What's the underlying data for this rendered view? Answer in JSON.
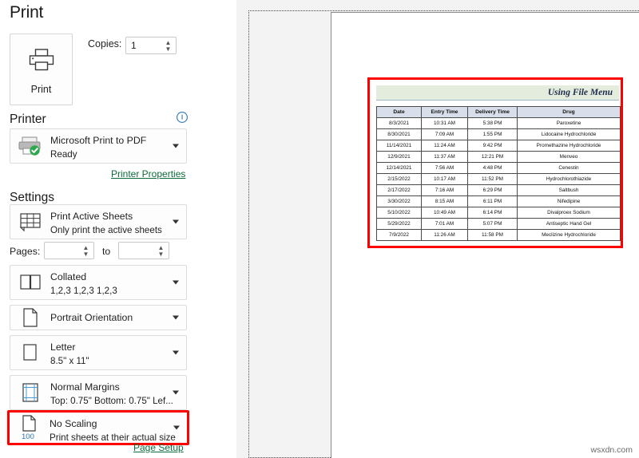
{
  "header": {
    "title": "Print"
  },
  "print_button": {
    "label": "Print",
    "icon": "printer-icon"
  },
  "copies": {
    "label": "Copies:",
    "value": "1"
  },
  "printer_section": {
    "heading": "Printer",
    "info_icon": "info-circle-icon",
    "name": "Microsoft Print to PDF",
    "status": "Ready",
    "icon": "printer-ready-icon",
    "properties_link": "Printer Properties"
  },
  "settings_section": {
    "heading": "Settings",
    "items": [
      {
        "icon": "worksheet-grid-icon",
        "primary": "Print Active Sheets",
        "secondary": "Only print the active sheets",
        "highlighted": false
      },
      {
        "icon": "collate-icon",
        "primary": "Collated",
        "secondary": "1,2,3   1,2,3   1,2,3",
        "highlighted": false
      },
      {
        "icon": "portrait-page-icon",
        "primary": "Portrait Orientation",
        "secondary": "",
        "highlighted": false
      },
      {
        "icon": "paper-size-icon",
        "primary": "Letter",
        "secondary": "8.5\" x 11\"",
        "highlighted": false
      },
      {
        "icon": "margins-icon",
        "primary": "Normal Margins",
        "secondary": "Top: 0.75\" Bottom: 0.75\" Lef...",
        "highlighted": false
      },
      {
        "icon": "scaling-icon",
        "icon_badge": "100",
        "primary": "No Scaling",
        "secondary": "Print sheets at their actual size",
        "highlighted": true
      }
    ],
    "pages": {
      "label": "Pages:",
      "from": "",
      "to_label": "to",
      "to": ""
    },
    "page_setup_link": "Page Setup"
  },
  "preview": {
    "sheet_title": "Using File Menu",
    "table": {
      "columns": [
        "Date",
        "Entry Time",
        "Delivery Time",
        "Drug"
      ],
      "rows": [
        [
          "8/3/2021",
          "10:31 AM",
          "5:38 PM",
          "Paroxetine"
        ],
        [
          "8/30/2021",
          "7:09 AM",
          "1:55 PM",
          "Lidocaine Hydrochloride"
        ],
        [
          "11/14/2021",
          "11:24 AM",
          "9:42 PM",
          "Promethazine Hydrochloride"
        ],
        [
          "12/9/2021",
          "11:37 AM",
          "12:21 PM",
          "Menveo"
        ],
        [
          "12/14/2021",
          "7:56 AM",
          "4:48 PM",
          "Cenestin"
        ],
        [
          "2/15/2022",
          "10:17 AM",
          "11:52 PM",
          "Hydrochlorothiazide"
        ],
        [
          "2/17/2022",
          "7:16 AM",
          "6:29 PM",
          "Saltbush"
        ],
        [
          "3/30/2022",
          "8:15 AM",
          "6:11 PM",
          "Nifedipine"
        ],
        [
          "5/10/2022",
          "10:49 AM",
          "6:14 PM",
          "Divalproex Sodium"
        ],
        [
          "5/29/2022",
          "7:01 AM",
          "5:07 PM",
          "Antiseptic Hand Gel"
        ],
        [
          "7/9/2022",
          "11:26 AM",
          "11:58 PM",
          "Meclizine Hydrochloride"
        ]
      ]
    }
  },
  "watermark": "wsxdn.com",
  "colors": {
    "highlight_red": "#ff0000",
    "link_green": "#0e6b3c",
    "title_band": "#e4ecdd",
    "table_header": "#d8dfea",
    "badge_blue": "#2e75b6"
  }
}
